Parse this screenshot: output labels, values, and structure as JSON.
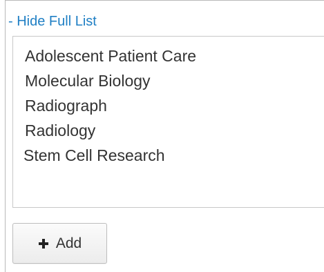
{
  "toggle": {
    "label": "- Hide Full List"
  },
  "list": {
    "items": [
      "Adolescent Patient Care",
      "Molecular Biology",
      "Radiograph",
      "Radiology",
      "Stem Cell Research"
    ]
  },
  "add_button": {
    "label": "Add",
    "icon": "plus-icon"
  },
  "colors": {
    "link": "#1f7fc4",
    "text": "#333333",
    "border": "#c8c8c8"
  }
}
